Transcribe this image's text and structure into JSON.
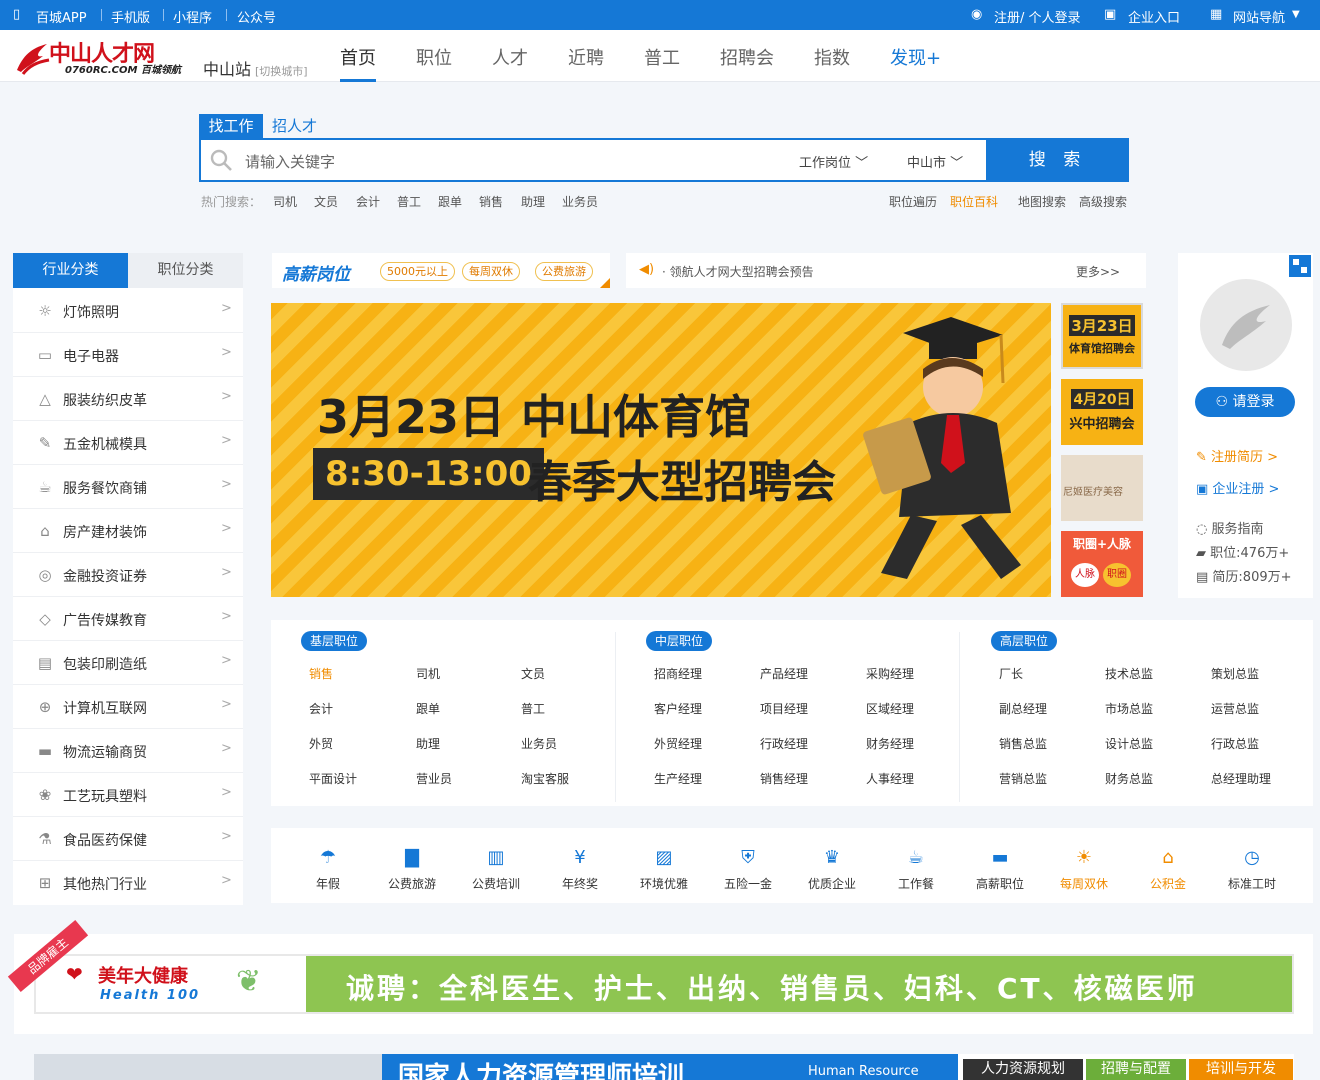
{
  "topbar": {
    "app": "百城APP",
    "mobile": "手机版",
    "mini": "小程序",
    "wechat": "公众号",
    "login": "注册/ 个人登录",
    "company_login": "企业入口",
    "site_nav": "网站导航"
  },
  "header": {
    "logo_main": "中山人才网",
    "logo_sub": "0760RC.COM 百城领航",
    "city": "中山站",
    "switch_city": "[切换城市]",
    "nav": [
      "首页",
      "职位",
      "人才",
      "近聘",
      "普工",
      "招聘会",
      "指数",
      "发现+"
    ]
  },
  "search": {
    "tab_job": "找工作",
    "tab_hire": "招人才",
    "placeholder": "请输入关键字",
    "type": "工作岗位",
    "city": "中山市",
    "button": "搜 索",
    "hot_label": "热门搜索：",
    "hot": [
      "司机",
      "文员",
      "会计",
      "普工",
      "跟单",
      "销售",
      "助理",
      "业务员"
    ],
    "links": [
      "职位遍历",
      "职位百科",
      "地图搜索",
      "高级搜索"
    ]
  },
  "left": {
    "tab_industry": "行业分类",
    "tab_position": "职位分类",
    "items": [
      "灯饰照明",
      "电子电器",
      "服装纺织皮革",
      "五金机械模具",
      "服务餐饮商铺",
      "房产建材装饰",
      "金融投资证券",
      "广告传媒教育",
      "包装印刷造纸",
      "计算机互联网",
      "物流运输商贸",
      "工艺玩具塑料",
      "食品医药保健",
      "其他热门行业"
    ]
  },
  "promo": {
    "brand": "高薪岗位",
    "tags": [
      "5000元以上",
      "每周双休",
      "公费旅游"
    ],
    "notice": "· 领航人才网大型招聘会预告",
    "more": "更多>>"
  },
  "banner": {
    "line1": "3月23日 中山体育馆",
    "time": "8:30-13:00",
    "line2": "春季大型招聘会",
    "side1_a": "3月23日",
    "side1_b": "体育馆招聘会",
    "side2_a": "4月20日",
    "side2_b": "兴中招聘会",
    "side3": "尼姬医疗美容",
    "side4": "职圈+人脉",
    "side4_a": "人脉",
    "side4_b": "职圈"
  },
  "card": {
    "login": "请登录",
    "resume": "注册简历 >",
    "company": "企业注册 >",
    "guide": "服务指南",
    "jobs": "职位:476万+",
    "resumes": "简历:809万+"
  },
  "jobs": {
    "basic": {
      "title": "基层职位",
      "items": [
        "销售",
        "司机",
        "文员",
        "会计",
        "跟单",
        "普工",
        "外贸",
        "助理",
        "业务员",
        "平面设计",
        "营业员",
        "淘宝客服"
      ]
    },
    "middle": {
      "title": "中层职位",
      "items": [
        "招商经理",
        "产品经理",
        "采购经理",
        "客户经理",
        "项目经理",
        "区域经理",
        "外贸经理",
        "行政经理",
        "财务经理",
        "生产经理",
        "销售经理",
        "人事经理"
      ]
    },
    "senior": {
      "title": "高层职位",
      "items": [
        "厂长",
        "技术总监",
        "策划总监",
        "副总经理",
        "市场总监",
        "运营总监",
        "销售总监",
        "设计总监",
        "行政总监",
        "营销总监",
        "财务总监",
        "总经理助理"
      ]
    }
  },
  "benefits": [
    {
      "label": "年假",
      "icon": "palm-icon"
    },
    {
      "label": "公费旅游",
      "icon": "bus-icon"
    },
    {
      "label": "公费培训",
      "icon": "training-icon"
    },
    {
      "label": "年终奖",
      "icon": "bonus-icon"
    },
    {
      "label": "环境优雅",
      "icon": "picture-icon"
    },
    {
      "label": "五险一金",
      "icon": "shield-icon"
    },
    {
      "label": "优质企业",
      "icon": "trophy-icon"
    },
    {
      "label": "工作餐",
      "icon": "meal-icon"
    },
    {
      "label": "高薪职位",
      "icon": "card-icon"
    },
    {
      "label": "每周双休",
      "icon": "sun-icon"
    },
    {
      "label": "公积金",
      "icon": "house-icon"
    },
    {
      "label": "标准工时",
      "icon": "clock-icon"
    }
  ],
  "ad": {
    "corner": "品牌雇主",
    "brand": "美年大健康",
    "brand_en": "Health 100",
    "text": "诚聘：全科医生、护士、出纳、销售员、妇科、CT、核磁医师"
  },
  "bottom": {
    "title": "国家人力资源管理师培训",
    "en": "Human Resource",
    "tags": [
      "人力资源规划",
      "招聘与配置",
      "培训与开发"
    ]
  },
  "colors": {
    "primary": "#1578d6",
    "accent": "#f08c00",
    "brand_red": "#d0111b"
  }
}
